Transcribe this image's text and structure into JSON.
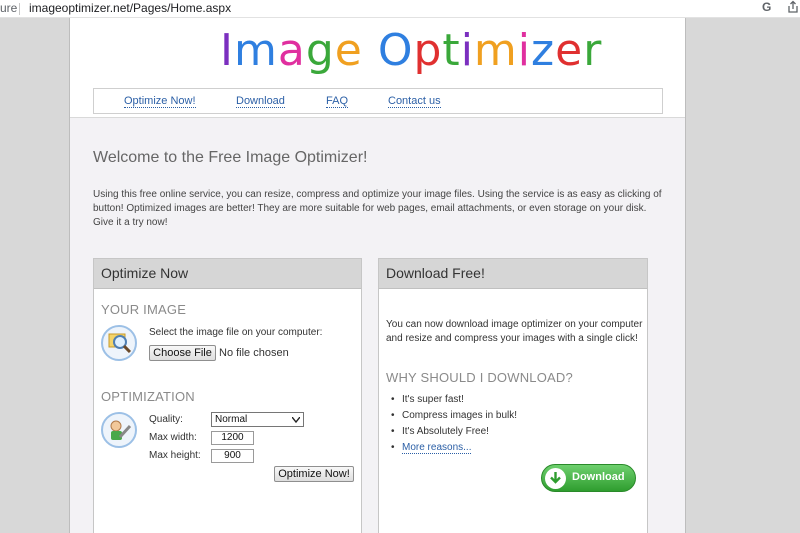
{
  "browser": {
    "security_prefix": "ure",
    "url": "imageoptimizer.net/Pages/Home.aspx",
    "google_icon": "G"
  },
  "header": {
    "logo_text": "Image Optimizer",
    "logo_colors": [
      "#7b2fbf",
      "#2f7fe0",
      "#e02f9f",
      "#3aa83a",
      "#f0a020",
      "#2f7fe0",
      "#e03030",
      "#3aa83a",
      "#7b2fbf",
      "#f0a020",
      "#e02f9f",
      "#2f7fe0",
      "#e03030",
      "#3aa83a",
      "#7b2fbf"
    ],
    "nav": [
      "Optimize Now!",
      "Download",
      "FAQ",
      "Contact us"
    ]
  },
  "main": {
    "welcome": "Welcome to the Free Image Optimizer!",
    "intro": "Using this free online service, you can resize, compress and optimize your image files. Using the service is as easy as clicking of button! Optimized images are better! They are more suitable for web pages, email attachments, or even storage on your disk. Give it a try now!"
  },
  "optimize": {
    "title": "Optimize Now",
    "your_image": "YOUR IMAGE",
    "select_prompt": "Select the image file on your computer:",
    "choose_file": "Choose File",
    "no_file": "No file chosen",
    "optimization": "OPTIMIZATION",
    "quality_label": "Quality:",
    "quality_value": "Normal",
    "max_width_label": "Max width:",
    "max_width_value": "1200",
    "max_height_label": "Max height:",
    "max_height_value": "900",
    "submit": "Optimize Now!"
  },
  "download": {
    "title": "Download Free!",
    "text": "You can now download image optimizer on your computer and resize and compress your images with a single click!",
    "why_title": "WHY SHOULD I DOWNLOAD?",
    "reasons": [
      "It's super fast!",
      "Compress images in bulk!",
      "It's Absolutely Free!"
    ],
    "more": "More reasons...",
    "button": "Download"
  },
  "colors": {
    "link": "#2b5fa6",
    "panel_header": "#d6d6d6",
    "download_green": "#3aa83a"
  }
}
